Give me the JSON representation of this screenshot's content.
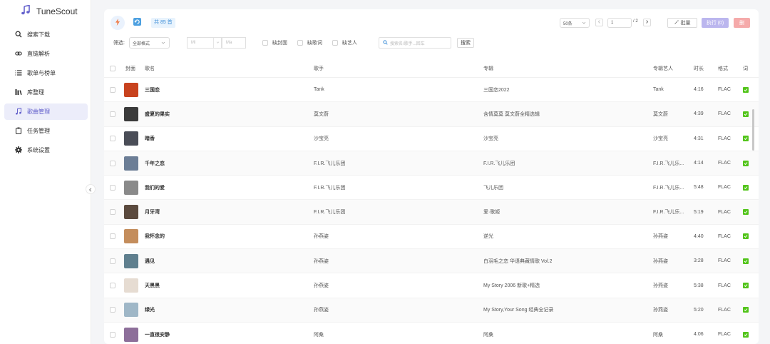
{
  "app": {
    "name": "TuneScout",
    "accent": "#6461cc"
  },
  "sidebar": {
    "items": [
      {
        "label": "搜索下载",
        "icon": "search-icon"
      },
      {
        "label": "直链解析",
        "icon": "link-icon"
      },
      {
        "label": "歌单与榜单",
        "icon": "list-icon"
      },
      {
        "label": "库整理",
        "icon": "library-icon"
      },
      {
        "label": "歌曲管理",
        "icon": "music-note-icon",
        "active": true
      },
      {
        "label": "任务管理",
        "icon": "clipboard-icon"
      },
      {
        "label": "系统设置",
        "icon": "gear-icon"
      }
    ]
  },
  "toolbar": {
    "count_label": "共 85 首",
    "page_size": "50条",
    "page_current": "1",
    "page_total": "/ 2",
    "batch_label": "批量",
    "execute_label": "执行 (0)",
    "delete_label": "删"
  },
  "filter": {
    "label": "筛选:",
    "format_value": "全部格式",
    "min_placeholder": "Mi",
    "max_placeholder": "Ma",
    "missing_cover": "缺封面",
    "missing_lyrics": "缺歌词",
    "missing_artist": "缺艺人",
    "search_placeholder": "搜索名/歌手...回车",
    "search_button": "搜索"
  },
  "table": {
    "headers": {
      "cover": "封面",
      "title": "歌名",
      "artist": "歌手",
      "album": "专辑",
      "album_artist": "专辑艺人",
      "duration": "时长",
      "format": "格式",
      "lyrics": "词"
    },
    "rows": [
      {
        "title": "三国恋",
        "artist": "Tank",
        "album": "三国恋2022",
        "album_artist": "Tank",
        "duration": "4:16",
        "format": "FLAC",
        "cover_color": "#c8421e"
      },
      {
        "title": "盛夏的果实",
        "artist": "莫文蔚",
        "album": "含情莫莫 莫文蔚全精选辑",
        "album_artist": "莫文蔚",
        "duration": "4:39",
        "format": "FLAC",
        "cover_color": "#3a3a3a"
      },
      {
        "title": "暗香",
        "artist": "沙宝亮",
        "album": "沙宝亮",
        "album_artist": "沙宝亮",
        "duration": "4:31",
        "format": "FLAC",
        "cover_color": "#4a4d57"
      },
      {
        "title": "千年之恋",
        "artist": "F.I.R.飞儿乐团",
        "album": "F.I.R.飞儿乐团",
        "album_artist": "F.I.R.飞儿乐...",
        "duration": "4:14",
        "format": "FLAC",
        "cover_color": "#6c7e96"
      },
      {
        "title": "我们的爱",
        "artist": "F.I.R.飞儿乐团",
        "album": "飞儿乐团",
        "album_artist": "F.I.R.飞儿乐...",
        "duration": "5:48",
        "format": "FLAC",
        "cover_color": "#8a8a8a"
      },
      {
        "title": "月牙湾",
        "artist": "F.I.R.飞儿乐团",
        "album": "爱·歌姬",
        "album_artist": "F.I.R.飞儿乐...",
        "duration": "5:19",
        "format": "FLAC",
        "cover_color": "#5b4a3e"
      },
      {
        "title": "我怀念的",
        "artist": "孙燕姿",
        "album": "逆光",
        "album_artist": "孙燕姿",
        "duration": "4:40",
        "format": "FLAC",
        "cover_color": "#c48d5c"
      },
      {
        "title": "遇见",
        "artist": "孙燕姿",
        "album": "白羽毛之恋 华语典藏情歌 Vol.2",
        "album_artist": "孙燕姿",
        "duration": "3:28",
        "format": "FLAC",
        "cover_color": "#5f7f8e"
      },
      {
        "title": "天黑黑",
        "artist": "孙燕姿",
        "album": "My Story 2006 新歌+精选",
        "album_artist": "孙燕姿",
        "duration": "5:38",
        "format": "FLAC",
        "cover_color": "#e6dcd2"
      },
      {
        "title": "绿光",
        "artist": "孙燕姿",
        "album": "My Story,Your Song 经典全记录",
        "album_artist": "孙燕姿",
        "duration": "5:20",
        "format": "FLAC",
        "cover_color": "#9fb7c7"
      },
      {
        "title": "一直很安静",
        "artist": "阿桑",
        "album": "阿桑",
        "album_artist": "阿桑",
        "duration": "4:06",
        "format": "FLAC",
        "cover_color": "#8d6f9a"
      }
    ]
  }
}
